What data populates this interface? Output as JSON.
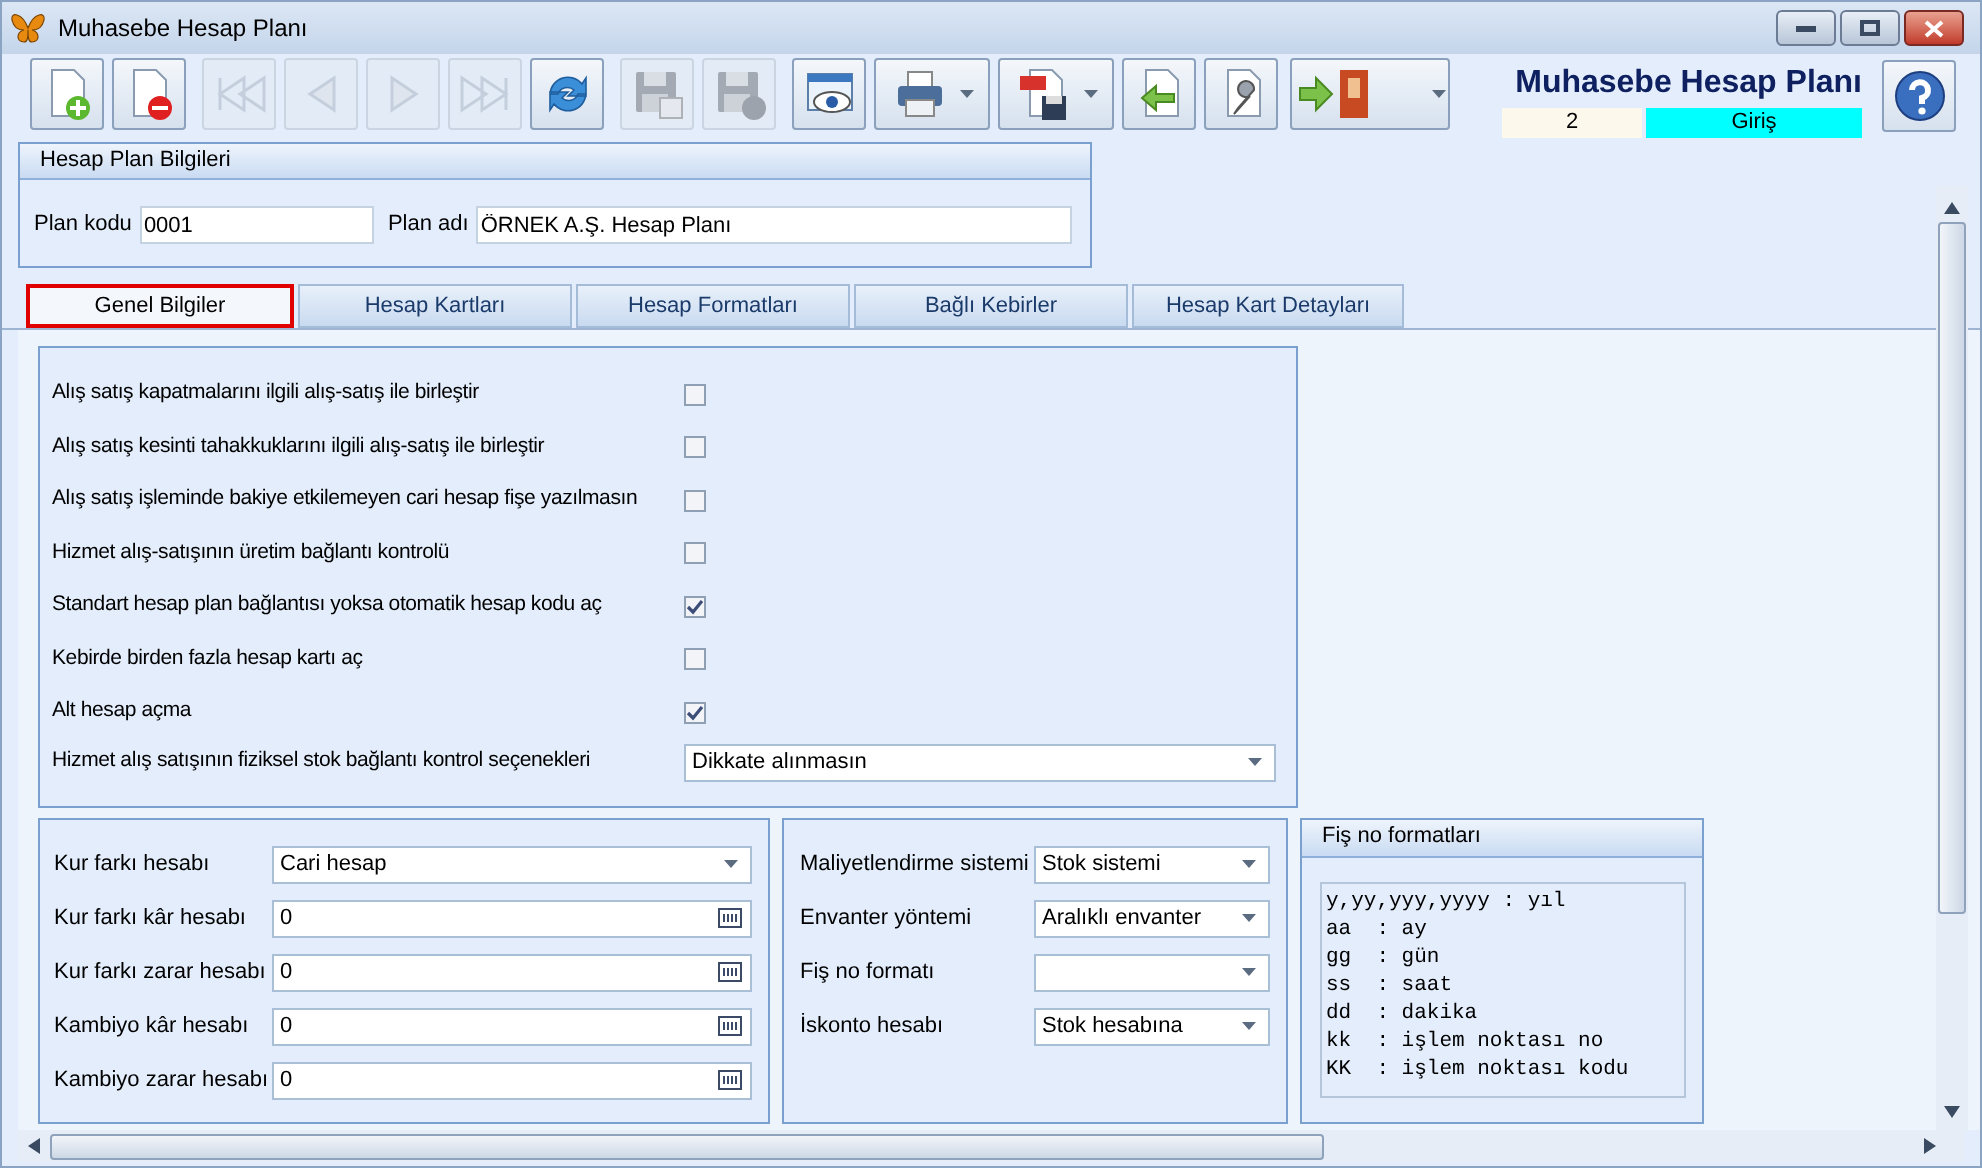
{
  "window": {
    "title": "Muhasebe Hesap Planı"
  },
  "toolbar": [
    {
      "kind": "new",
      "disabled": false,
      "dropdown": false
    },
    {
      "kind": "delete",
      "disabled": false,
      "dropdown": false
    },
    {
      "kind": "first",
      "disabled": true,
      "dropdown": false
    },
    {
      "kind": "prev",
      "disabled": true,
      "dropdown": false
    },
    {
      "kind": "next",
      "disabled": true,
      "dropdown": false
    },
    {
      "kind": "last",
      "disabled": true,
      "dropdown": false
    },
    {
      "kind": "refresh",
      "disabled": false,
      "dropdown": false
    },
    {
      "kind": "save",
      "disabled": true,
      "dropdown": false
    },
    {
      "kind": "cancel",
      "disabled": true,
      "dropdown": false
    },
    {
      "kind": "preview",
      "disabled": false,
      "dropdown": false
    },
    {
      "kind": "print",
      "disabled": false,
      "dropdown": true
    },
    {
      "kind": "pdf",
      "disabled": false,
      "dropdown": true
    },
    {
      "kind": "import",
      "disabled": false,
      "dropdown": false
    },
    {
      "kind": "settings",
      "disabled": false,
      "dropdown": false
    },
    {
      "kind": "exit",
      "disabled": false,
      "dropdown": true
    }
  ],
  "header": {
    "title": "Muhasebe Hesap Planı",
    "record": "2",
    "mode": "Giriş"
  },
  "plan_info": {
    "title": "Hesap Plan Bilgileri",
    "code_label": "Plan kodu",
    "code": "0001",
    "name_label": "Plan adı",
    "name": "ÖRNEK A.Ş. Hesap Planı"
  },
  "tabs": [
    {
      "label": "Genel Bilgiler",
      "selected": true
    },
    {
      "label": "Hesap Kartları",
      "selected": false
    },
    {
      "label": "Hesap Formatları",
      "selected": false
    },
    {
      "label": "Bağlı Kebirler",
      "selected": false
    },
    {
      "label": "Hesap Kart Detayları",
      "selected": false
    }
  ],
  "options": [
    {
      "label": "Alış satış kapatmalarını ilgili alış-satış ile birleştir",
      "checked": false
    },
    {
      "label": "Alış satış kesinti tahakkuklarını ilgili alış-satış ile birleştir",
      "checked": false
    },
    {
      "label": "Alış satış işleminde bakiye etkilemeyen cari hesap fişe yazılmasın",
      "checked": false
    },
    {
      "label": "Hizmet alış-satışının üretim bağlantı kontrolü",
      "checked": false
    },
    {
      "label": "Standart hesap plan bağlantısı yoksa otomatik hesap kodu aç",
      "checked": true
    },
    {
      "label": "Kebirde birden fazla hesap kartı aç",
      "checked": false
    },
    {
      "label": "Alt hesap açma",
      "checked": true
    }
  ],
  "stock_control": {
    "label": "Hizmet alış satışının fiziksel stok bağlantı kontrol seçenekleri",
    "value": "Dikkate alınmasın"
  },
  "accounts": [
    {
      "kind": "select",
      "label": "Kur farkı hesabı",
      "value": "Cari hesap"
    },
    {
      "kind": "lookup",
      "label": "Kur farkı kâr hesabı",
      "value": "0"
    },
    {
      "kind": "lookup",
      "label": "Kur farkı zarar hesabı",
      "value": "0"
    },
    {
      "kind": "lookup",
      "label": "Kambiyo kâr hesabı",
      "value": "0"
    },
    {
      "kind": "lookup",
      "label": "Kambiyo zarar hesabı",
      "value": "0"
    }
  ],
  "costing": [
    {
      "label": "Maliyetlendirme sistemi",
      "value": "Stok sistemi"
    },
    {
      "label": "Envanter yöntemi",
      "value": "Aralıklı envanter"
    },
    {
      "label": "Fiş no formatı"
    },
    {
      "label": "İskonto hesabı",
      "value": "Stok hesabına"
    }
  ],
  "formats": {
    "title": "Fiş no formatları",
    "lines": [
      "y,yy,yyy,yyyy : yıl",
      "aa  : ay",
      "gg  : gün",
      "ss  : saat",
      "dd  : dakika",
      "kk  : işlem noktası no",
      "KK  : işlem noktası kodu"
    ]
  }
}
